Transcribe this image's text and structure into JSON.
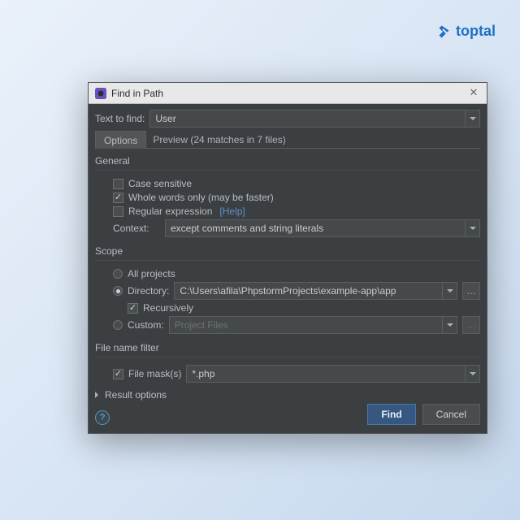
{
  "brand": "toptal",
  "window": {
    "title": "Find in Path"
  },
  "find": {
    "text_to_find_label": "Text to find:",
    "value": "User"
  },
  "tabs": {
    "options_label": "Options",
    "preview_label": "Preview (24 matches in 7 files)"
  },
  "general": {
    "title": "General",
    "case_sensitive": {
      "label": "Case sensitive",
      "checked": false
    },
    "whole_words": {
      "label": "Whole words only (may be faster)",
      "checked": true
    },
    "regex": {
      "label": "Regular expression",
      "checked": false,
      "help_label": "[Help]"
    },
    "context_label": "Context:",
    "context_value": "except comments and string literals"
  },
  "scope": {
    "title": "Scope",
    "all_projects": {
      "label": "All projects",
      "selected": false
    },
    "directory": {
      "label": "Directory:",
      "selected": true,
      "path": "C:\\Users\\afila\\PhpstormProjects\\example-app\\app"
    },
    "recursively": {
      "label": "Recursively",
      "checked": true
    },
    "custom": {
      "label": "Custom:",
      "selected": false,
      "value": "Project Files"
    }
  },
  "file_filter": {
    "title": "File name filter",
    "mask": {
      "label": "File mask(s)",
      "checked": true,
      "value": "*.php"
    }
  },
  "result_options": {
    "title": "Result options"
  },
  "buttons": {
    "find": "Find",
    "cancel": "Cancel"
  }
}
